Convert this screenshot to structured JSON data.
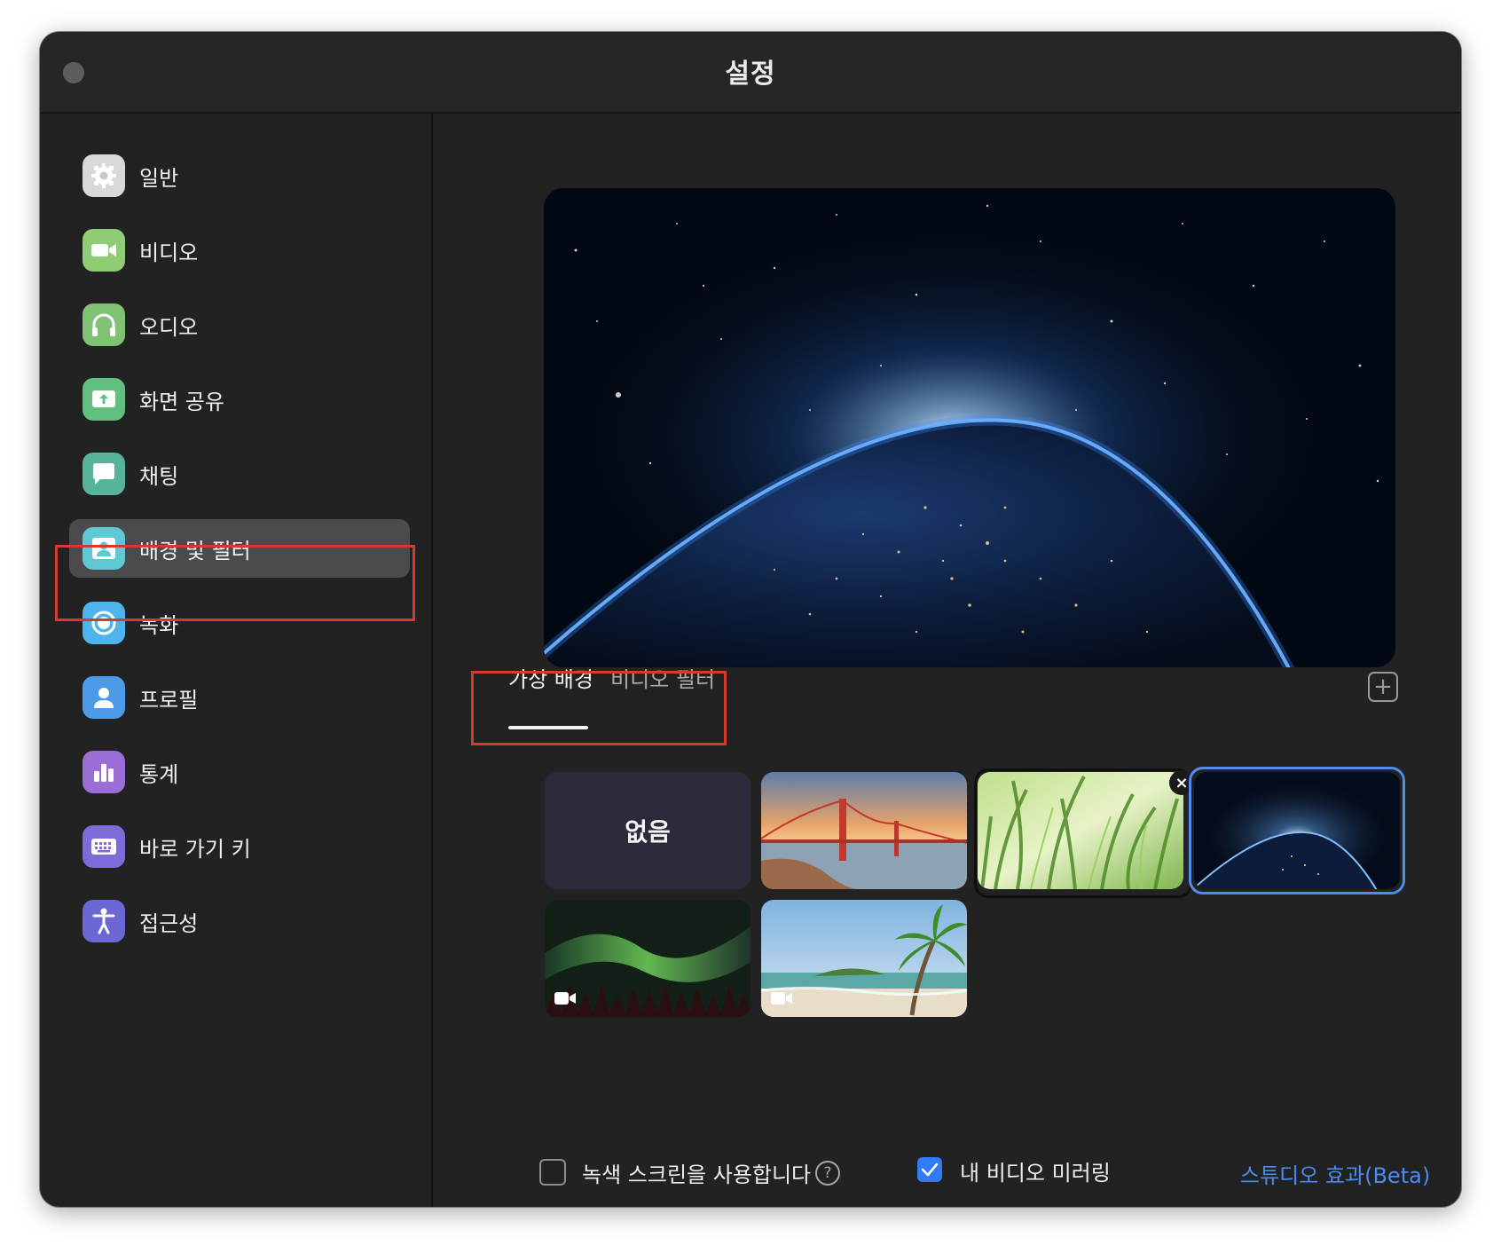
{
  "window": {
    "title": "설정"
  },
  "sidebar": {
    "items": [
      {
        "label": "일반",
        "icon": "gear-icon",
        "color": "#d9d9d9"
      },
      {
        "label": "비디오",
        "icon": "video-camera-icon",
        "color": "#8fcc74"
      },
      {
        "label": "오디오",
        "icon": "headphones-icon",
        "color": "#7fc274"
      },
      {
        "label": "화면 공유",
        "icon": "share-screen-icon",
        "color": "#62c07e"
      },
      {
        "label": "채팅",
        "icon": "chat-bubble-icon",
        "color": "#58b39b"
      },
      {
        "label": "배경 및 필터",
        "icon": "person-background-icon",
        "color": "#5ec8d3"
      },
      {
        "label": "녹화",
        "icon": "record-icon",
        "color": "#4fb4ec"
      },
      {
        "label": "프로필",
        "icon": "profile-person-icon",
        "color": "#4d9ae8"
      },
      {
        "label": "통계",
        "icon": "bar-chart-icon",
        "color": "#9b6ed6"
      },
      {
        "label": "바로 가기 키",
        "icon": "keyboard-icon",
        "color": "#8069d9"
      },
      {
        "label": "접근성",
        "icon": "accessibility-icon",
        "color": "#6b68d4"
      }
    ],
    "active_index": 5
  },
  "tabs": {
    "virtual_background": "가상 배경",
    "video_filter": "비디오 필터",
    "active": "virtual_background"
  },
  "backgrounds": {
    "none_label": "없음",
    "items": [
      {
        "name": "none",
        "selected": false
      },
      {
        "name": "golden-gate-bridge",
        "selected": false
      },
      {
        "name": "green-grass",
        "selected": false,
        "removable": true
      },
      {
        "name": "earth-from-space",
        "selected": true
      },
      {
        "name": "northern-lights",
        "selected": false,
        "video": true
      },
      {
        "name": "tropical-beach",
        "selected": false,
        "video": true
      }
    ]
  },
  "footer": {
    "green_screen_label": "녹색 스크린을 사용합니다",
    "green_screen_checked": false,
    "mirror_label": "내 비디오 미러링",
    "mirror_checked": true,
    "studio_effects_link": "스튜디오 효과(Beta)"
  },
  "colors": {
    "accent": "#2f7cf6",
    "link": "#4a8bf0",
    "highlight": "#d9392b",
    "selected_ring": "#4e8cf0"
  }
}
